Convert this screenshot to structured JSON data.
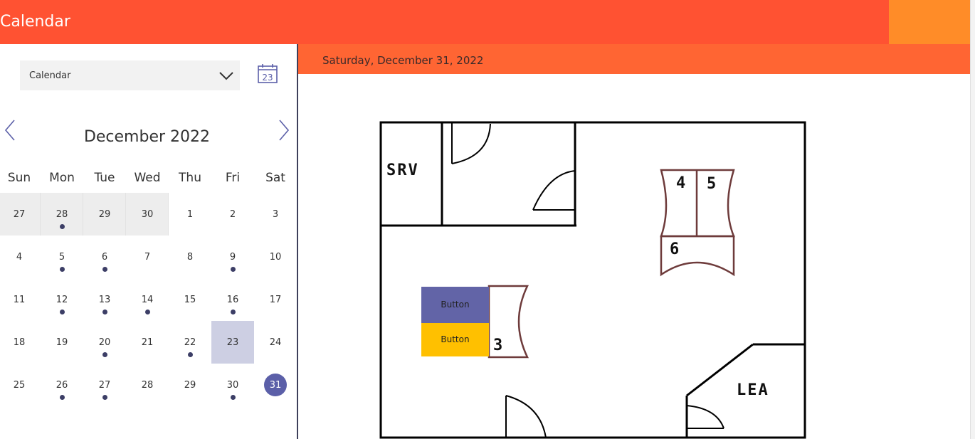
{
  "app": {
    "title": "Calendar"
  },
  "sidebar": {
    "dropdown_value": "Calendar",
    "calendar_icon_number": "23",
    "month_title": "December 2022",
    "weekdays": [
      "Sun",
      "Mon",
      "Tue",
      "Wed",
      "Thu",
      "Fri",
      "Sat"
    ],
    "weeks": [
      [
        {
          "d": "27",
          "muted": true
        },
        {
          "d": "28",
          "muted": true,
          "dot": true
        },
        {
          "d": "29",
          "muted": true
        },
        {
          "d": "30",
          "muted": true
        },
        {
          "d": "1"
        },
        {
          "d": "2"
        },
        {
          "d": "3"
        }
      ],
      [
        {
          "d": "4"
        },
        {
          "d": "5",
          "dot": true
        },
        {
          "d": "6",
          "dot": true
        },
        {
          "d": "7"
        },
        {
          "d": "8"
        },
        {
          "d": "9",
          "dot": true
        },
        {
          "d": "10"
        }
      ],
      [
        {
          "d": "11"
        },
        {
          "d": "12",
          "dot": true
        },
        {
          "d": "13",
          "dot": true
        },
        {
          "d": "14",
          "dot": true
        },
        {
          "d": "15"
        },
        {
          "d": "16",
          "dot": true
        },
        {
          "d": "17"
        }
      ],
      [
        {
          "d": "18"
        },
        {
          "d": "19"
        },
        {
          "d": "20",
          "dot": true
        },
        {
          "d": "21"
        },
        {
          "d": "22",
          "dot": true
        },
        {
          "d": "23",
          "highlight": true
        },
        {
          "d": "24"
        }
      ],
      [
        {
          "d": "25"
        },
        {
          "d": "26",
          "dot": true
        },
        {
          "d": "27",
          "dot": true
        },
        {
          "d": "28"
        },
        {
          "d": "29"
        },
        {
          "d": "30",
          "dot": true
        },
        {
          "d": "31",
          "today": true
        }
      ]
    ]
  },
  "main": {
    "selected_date": "Saturday, December 31, 2022",
    "floorplan": {
      "rooms": [
        "SRV",
        "LEA"
      ],
      "desks": [
        "4",
        "5",
        "6",
        "3"
      ],
      "buttons": [
        {
          "label": "Button"
        },
        {
          "label": "Button"
        }
      ]
    }
  },
  "colors": {
    "header": "#ff5232",
    "accent": "#ff8c28",
    "date_bar": "#ff6533",
    "primary": "#6264a7",
    "secondary": "#ffc000",
    "week_highlight": "#cdcfe3"
  }
}
